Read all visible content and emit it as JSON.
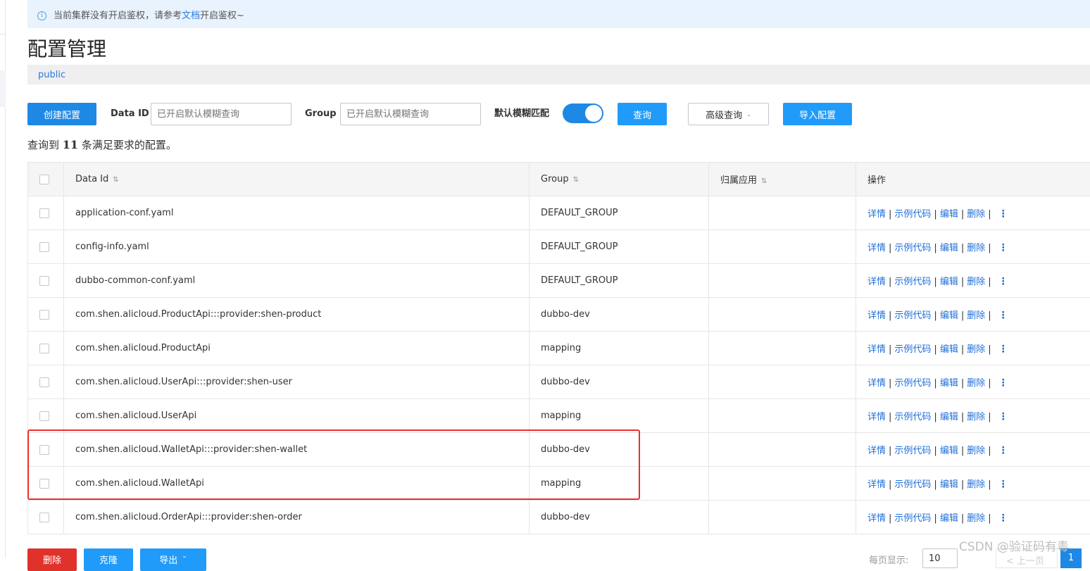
{
  "notice": {
    "prefix": "当前集群没有开启鉴权，请参考",
    "link": "文档",
    "suffix": "开启鉴权~"
  },
  "page_title": "配置管理",
  "namespace": "public",
  "toolbar": {
    "create_label": "创建配置",
    "data_id_label": "Data ID",
    "data_id_placeholder": "已开启默认模糊查询",
    "group_label": "Group",
    "group_placeholder": "已开启默认模糊查询",
    "fuzzy_label": "默认模糊匹配",
    "fuzzy_on": true,
    "query_label": "查询",
    "advanced_label": "高级查询",
    "import_label": "导入配置"
  },
  "result": {
    "prefix": "查询到",
    "count": "11",
    "suffix": "条满足要求的配置。"
  },
  "table": {
    "headers": {
      "data_id": "Data Id",
      "group": "Group",
      "app": "归属应用",
      "ops": "操作"
    },
    "ops": {
      "detail": "详情",
      "sample": "示例代码",
      "edit": "编辑",
      "delete": "删除",
      "sep": "|"
    },
    "rows": [
      {
        "data_id": "application-conf.yaml",
        "group": "DEFAULT_GROUP",
        "app": ""
      },
      {
        "data_id": "config-info.yaml",
        "group": "DEFAULT_GROUP",
        "app": ""
      },
      {
        "data_id": "dubbo-common-conf.yaml",
        "group": "DEFAULT_GROUP",
        "app": ""
      },
      {
        "data_id": "com.shen.alicloud.ProductApi:::provider:shen-product",
        "group": "dubbo-dev",
        "app": ""
      },
      {
        "data_id": "com.shen.alicloud.ProductApi",
        "group": "mapping",
        "app": ""
      },
      {
        "data_id": "com.shen.alicloud.UserApi:::provider:shen-user",
        "group": "dubbo-dev",
        "app": ""
      },
      {
        "data_id": "com.shen.alicloud.UserApi",
        "group": "mapping",
        "app": ""
      },
      {
        "data_id": "com.shen.alicloud.WalletApi:::provider:shen-wallet",
        "group": "dubbo-dev",
        "app": ""
      },
      {
        "data_id": "com.shen.alicloud.WalletApi",
        "group": "mapping",
        "app": ""
      },
      {
        "data_id": "com.shen.alicloud.OrderApi:::provider:shen-order",
        "group": "dubbo-dev",
        "app": ""
      }
    ]
  },
  "footer": {
    "delete_label": "删除",
    "clone_label": "克隆",
    "export_label": "导出",
    "page_size_label": "每页显示:",
    "page_size": "10",
    "prev_label": "< 上一页",
    "current_page": "1"
  },
  "watermark": "CSDN @验证码有毒"
}
